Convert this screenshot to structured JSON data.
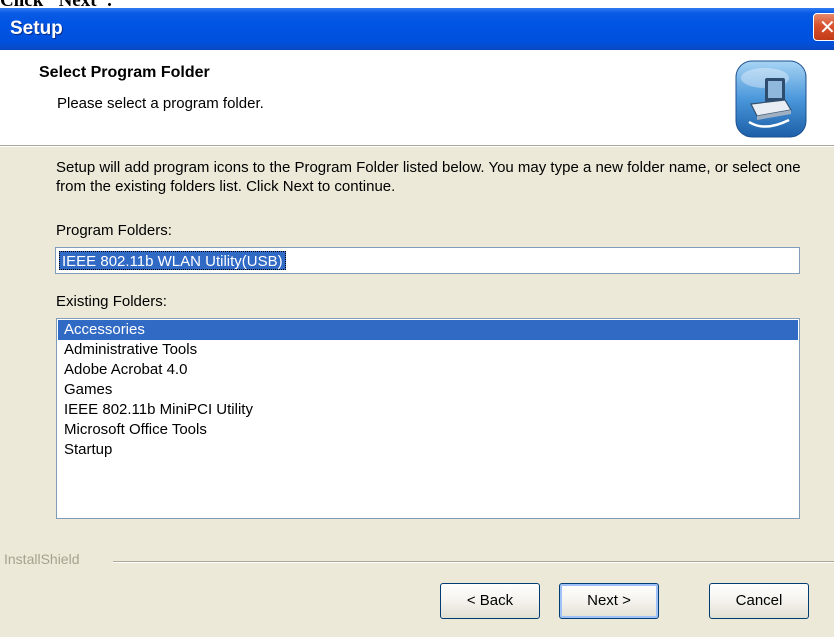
{
  "caption": "Click \"Next\".",
  "window": {
    "title": "Setup",
    "close_icon": "close-x-icon"
  },
  "header": {
    "title": "Select Program Folder",
    "subtitle": "Please select a program folder.",
    "icon": "computer-setup-icon"
  },
  "intro_text": "Setup will add program icons to the Program Folder listed below.  You may type a new folder name, or select one from the existing folders list.  Click Next to continue.",
  "program_folder": {
    "label": "Program Folders:",
    "value": "IEEE 802.11b WLAN Utility(USB)"
  },
  "existing_folders": {
    "label": "Existing Folders:",
    "items": [
      "Accessories",
      "Administrative Tools",
      "Adobe Acrobat 4.0",
      "Games",
      "IEEE 802.11b MiniPCI Utility",
      "Microsoft Office Tools",
      "Startup"
    ],
    "selected_index": 0
  },
  "footer": {
    "brand": "InstallShield"
  },
  "buttons": {
    "back": "< Back",
    "next": "Next >",
    "cancel": "Cancel"
  },
  "colors": {
    "titlebar": "#0054e3",
    "selection": "#316ac5",
    "dialog_bg": "#ece9d8"
  }
}
